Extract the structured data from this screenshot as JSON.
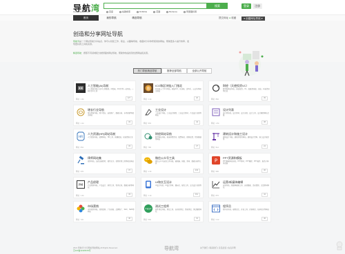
{
  "header": {
    "logo_text": "导航",
    "logo_accent": "湾",
    "logo_sub": "Daohangwan.com",
    "search_placeholder": "",
    "search_button": "搜索",
    "engines": [
      "百度",
      "谷歌搜索",
      "Dribbble",
      "花瓣",
      "Behance",
      "阿里图标库"
    ],
    "btn_primary": "登录",
    "btn_secondary": "注册"
  },
  "nav": {
    "items": [
      "首页",
      "我的导航",
      "精选导航"
    ],
    "active_index": 0,
    "submit_prefix": "提交网址 ",
    "submit_accent": "●",
    "submit_suffix": " 收藏",
    "user_button": "● 创建网址导航 ▾"
  },
  "hero": {
    "title": "创造和分享网址导航",
    "p1_label": "导航湾",
    "p1": "是一个网址导航分享站点，你可以创建工作、职业、兴趣等导航，收藏并分享你所使用的网站，帮助更多人提升效率，发现更好的工具和资源。",
    "p2_label": "精选导航",
    "p2": "：按照不同领域和分类整理的网址导航，帮助你快速找到优质网站和资源。"
  },
  "tabs": {
    "items": [
      "热门导航精选导航",
      "推荐全部导航",
      "全部公开导航"
    ],
    "active_index": 0
  },
  "cards": [
    {
      "name": "人工智能(AI)导航",
      "desc": "人工智能导航汇总AI工具整理，AI绘画、AI写作等一站导航，一网打尽AI工具",
      "meta": "网址: 1.6k",
      "count": "127"
    },
    {
      "name": "ICO和区块链入门指北",
      "desc": "区块链入门学习导航，收集ICO、区块链、比特币、以太坊等相关网站",
      "meta": "网址: 1.2k",
      "count": "20"
    },
    {
      "name": "财经（天使投资VC）",
      "desc": "财经类网站导航，天使投资，VC，投融资创投、创业、科技资讯等信息",
      "meta": "网址: 892",
      "count": "35"
    },
    {
      "name": "增长行业导航",
      "desc": "增长黑客导航，用户增长、运营推广、数据分析、市场营销等相关网站",
      "meta": "网址: 1.1k",
      "count": "33"
    },
    {
      "name": "工业设计",
      "desc": "工业设计导航，工业设计教程、工业设计素材、产品设计灵感等网站",
      "meta": "网址: 963",
      "count": "44"
    },
    {
      "name": "设计列表",
      "desc": "设计师导航，设计素材、设计灵感、设计工具、设计教程网站合集",
      "meta": "网址: 1.5k",
      "count": "38"
    },
    {
      "name": "人力资源(HR)网站导航",
      "desc": "人力资源导航，招聘网站、HR工具、薪酬绩效、培训资源大全",
      "meta": "网址: 654",
      "count": "33"
    },
    {
      "name": "财经网站导航",
      "desc": "财经网站导航，收录财经资讯、股票基金、理财投资、经济数据等网站",
      "meta": "网址: 780",
      "count": "27"
    },
    {
      "name": "建筑设计和施工设计",
      "desc": "建筑设计导航，建筑师常用网站，建筑设计资料、施工设计规范等",
      "meta": "网址: 512",
      "count": "24"
    },
    {
      "name": "律师网站集",
      "desc": "律师导航，法律法规检索、裁判文书、律师常用工具等相关网站",
      "meta": "网址: 433",
      "count": "37"
    },
    {
      "name": "微信公众号工具",
      "desc": "微信公众号运营工具导航，编辑器、排版、素材、数据分析等工具",
      "meta": "网址: 1.3k",
      "count": "443"
    },
    {
      "name": "PPT资源和模板",
      "desc": "PPT模板网站导航，PPT素材、PPT教程、PPT插件、配色字体等资源",
      "meta": "网址: 990",
      "count": "36"
    },
    {
      "name": "产品经理",
      "desc": "产品经理导航，产品设计、原型工具、需求文档、数据分析等网站",
      "meta": "网址: 1.4k",
      "count": "43"
    },
    {
      "name": "UI和交互设计",
      "desc": "UI设计导航，UI设计素材、图标库、配色工具、交互设计灵感等",
      "meta": "网址: 1.1k",
      "count": "311"
    },
    {
      "name": "运营/新媒体编辑",
      "desc": "运营导航，新媒体编辑工具、运营数据、活动策划、文案素材网站",
      "meta": "网址: 870",
      "count": "44"
    },
    {
      "name": "市场营销",
      "desc": "市场营销导航，营销案例、广告创意、品牌推广、SEO、SEM等网站",
      "meta": "网址: 720",
      "count": "40"
    },
    {
      "name": "测试工程师",
      "desc": "软件测试导航，测试工具、自动化测试、性能测试、测试教程网站",
      "meta": "网址: 560",
      "count": "31"
    },
    {
      "name": "程序员",
      "desc": "程序员导航，编程语言、开发工具、开源项目、技术社区等网站",
      "meta": "网址: 2.1k",
      "count": "46"
    }
  ],
  "footer": {
    "copyright": "2021 导航湾 分享网址导航网站 All Rights Reserved.",
    "icp": "京ICP备12345678号",
    "mid_logo": "导航湾",
    "right": "关于我们 | 联系我们 | 意见反馈 | 免责声明"
  },
  "colors": {
    "accent": "#4cae4c",
    "dark": "#333333"
  }
}
